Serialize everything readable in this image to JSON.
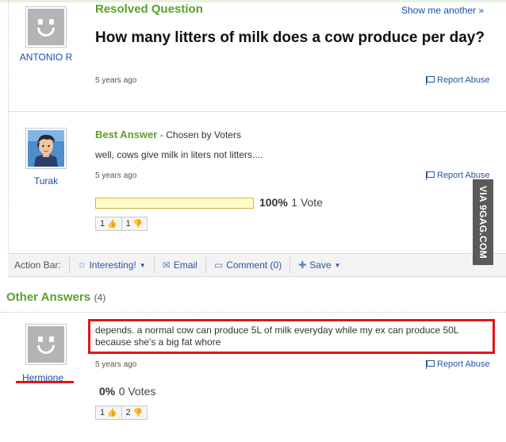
{
  "question": {
    "status_label": "Resolved Question",
    "show_another": "Show me another »",
    "title": "How many litters of milk does a cow produce per day?",
    "asker": "ANTONIO R",
    "age": "5 years ago",
    "report": "Report Abuse"
  },
  "best_answer": {
    "label": "Best Answer",
    "chosen_by": "- Chosen by Voters",
    "text": "well, cows give milk in liters not litters....",
    "user": "Turak",
    "age": "5 years ago",
    "report": "Report Abuse",
    "vote_percent": "100%",
    "vote_count": "1 Vote",
    "vote_fraction": 1.0,
    "thumbs_up": "1",
    "thumbs_down": "1"
  },
  "action_bar": {
    "label": "Action Bar:",
    "interesting": "Interesting!",
    "email": "Email",
    "comment": "Comment (0)",
    "save": "Save"
  },
  "other_answers": {
    "title": "Other Answers",
    "count": "(4)",
    "items": [
      {
        "user": "Hermione",
        "text": "depends. a normal cow can produce 5L of milk everyday while my ex can produce 50L because she's a big fat whore",
        "age": "5 years ago",
        "report": "Report Abuse",
        "vote_percent": "0%",
        "vote_count": "0 Votes",
        "thumbs_up": "1",
        "thumbs_down": "2"
      }
    ]
  },
  "watermark": "VIA 9GAG.COM",
  "colors": {
    "accent_green": "#5aa02c",
    "link_blue": "#1a4ea8",
    "highlight_red": "#e3141a"
  }
}
